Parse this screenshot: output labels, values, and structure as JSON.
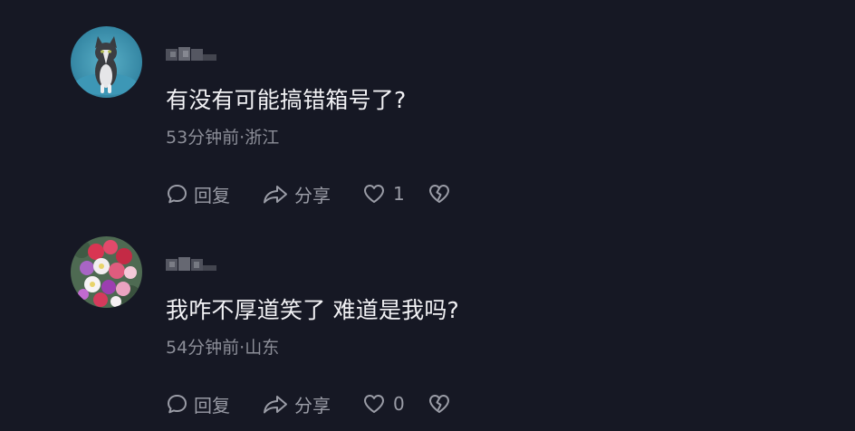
{
  "comments": [
    {
      "text": "有没有可能搞错箱号了?",
      "time": "53分钟前",
      "location": "浙江",
      "meta": "53分钟前·浙江",
      "reply_label": "回复",
      "share_label": "分享",
      "like_count": "1"
    },
    {
      "text": "我咋不厚道笑了 难道是我吗?",
      "time": "54分钟前",
      "location": "山东",
      "meta": "54分钟前·山东",
      "reply_label": "回复",
      "share_label": "分享",
      "like_count": "0"
    }
  ],
  "icons": {
    "reply": "comment-bubble-icon",
    "share": "share-arrow-icon",
    "like": "heart-icon",
    "dislike": "broken-heart-icon"
  },
  "colors": {
    "background": "#161824",
    "text": "#f1f1f4",
    "meta": "#8c8e98",
    "action": "#9a9ca6"
  }
}
